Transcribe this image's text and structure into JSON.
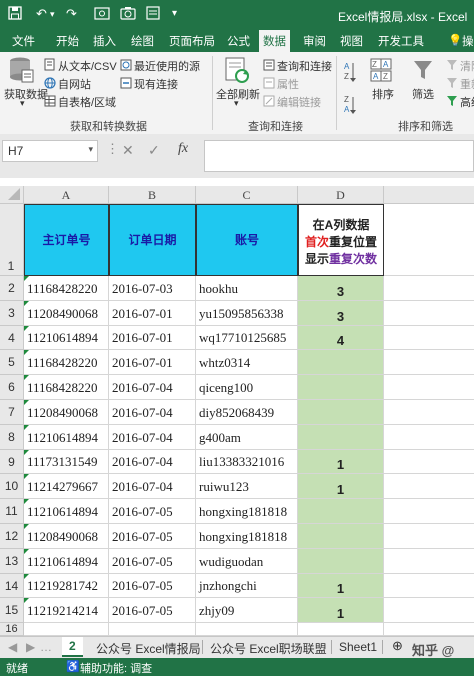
{
  "titlebar": {
    "title": "Excel情报局.xlsx  -  Excel"
  },
  "ribbon_tabs": [
    "文件",
    "开始",
    "插入",
    "绘图",
    "页面布局",
    "公式",
    "数据",
    "审阅",
    "视图",
    "开发工具",
    "操"
  ],
  "ribbon": {
    "get_data": "获取数据",
    "from_text": "从文本/CSV",
    "from_web": "自网站",
    "from_table": "自表格/区域",
    "recent": "最近使用的源",
    "existing": "现有连接",
    "refresh_all": "全部刷新",
    "queries": "查询和连接",
    "properties": "属性",
    "edit_links": "编辑链接",
    "sort": "排序",
    "filter": "筛选",
    "clear": "清除",
    "reapply": "重新",
    "advanced": "高级",
    "group1": "获取和转换数据",
    "group2": "查询和连接",
    "group3": "排序和筛选"
  },
  "formula_bar": {
    "name_box": "H7",
    "formula": "",
    "fx": "fx"
  },
  "columns": [
    "A",
    "B",
    "C",
    "D"
  ],
  "header_row": {
    "a": "主订单号",
    "b": "订单日期",
    "c": "账号",
    "d_line1": "在A列数据",
    "d_line2a": "首次",
    "d_line2b": "重复位置",
    "d_line3a": "显示",
    "d_line3b": "重复次数"
  },
  "rows": [
    {
      "n": "2",
      "a": "11168428220",
      "b": "2016-07-03",
      "c": "hookhu",
      "d": "3"
    },
    {
      "n": "3",
      "a": "11208490068",
      "b": "2016-07-01",
      "c": "yu15095856338",
      "d": "3"
    },
    {
      "n": "4",
      "a": "11210614894",
      "b": "2016-07-01",
      "c": "wq17710125685",
      "d": "4"
    },
    {
      "n": "5",
      "a": "11168428220",
      "b": "2016-07-01",
      "c": "whtz0314",
      "d": ""
    },
    {
      "n": "6",
      "a": "11168428220",
      "b": "2016-07-04",
      "c": "qiceng100",
      "d": ""
    },
    {
      "n": "7",
      "a": "11208490068",
      "b": "2016-07-04",
      "c": "diy852068439",
      "d": ""
    },
    {
      "n": "8",
      "a": "11210614894",
      "b": "2016-07-04",
      "c": "g400am",
      "d": ""
    },
    {
      "n": "9",
      "a": "11173131549",
      "b": "2016-07-04",
      "c": "liu13383321016",
      "d": "1"
    },
    {
      "n": "10",
      "a": "11214279667",
      "b": "2016-07-04",
      "c": "ruiwu123",
      "d": "1"
    },
    {
      "n": "11",
      "a": "11210614894",
      "b": "2016-07-05",
      "c": "hongxing181818",
      "d": ""
    },
    {
      "n": "12",
      "a": "11208490068",
      "b": "2016-07-05",
      "c": "hongxing181818",
      "d": ""
    },
    {
      "n": "13",
      "a": "11210614894",
      "b": "2016-07-05",
      "c": "wudiguodan",
      "d": ""
    },
    {
      "n": "14",
      "a": "11219281742",
      "b": "2016-07-05",
      "c": "jnzhongchi",
      "d": "1"
    },
    {
      "n": "15",
      "a": "11219214214",
      "b": "2016-07-05",
      "c": "zhjy09",
      "d": "1"
    }
  ],
  "row_labels": {
    "header": "1",
    "last": "16"
  },
  "sheet_tabs": [
    "2",
    "公众号 Excel情报局",
    "公众号 Excel职场联盟",
    "Sheet1"
  ],
  "status": {
    "ready": "就绪",
    "accessibility": "辅助功能: 调查",
    "watermark": "知乎 @"
  },
  "colors": {
    "excel_green": "#217346",
    "header_blue": "#1fc8f0",
    "result_green": "#c5e0b4",
    "red": "#e02020",
    "purple": "#7030a0"
  }
}
